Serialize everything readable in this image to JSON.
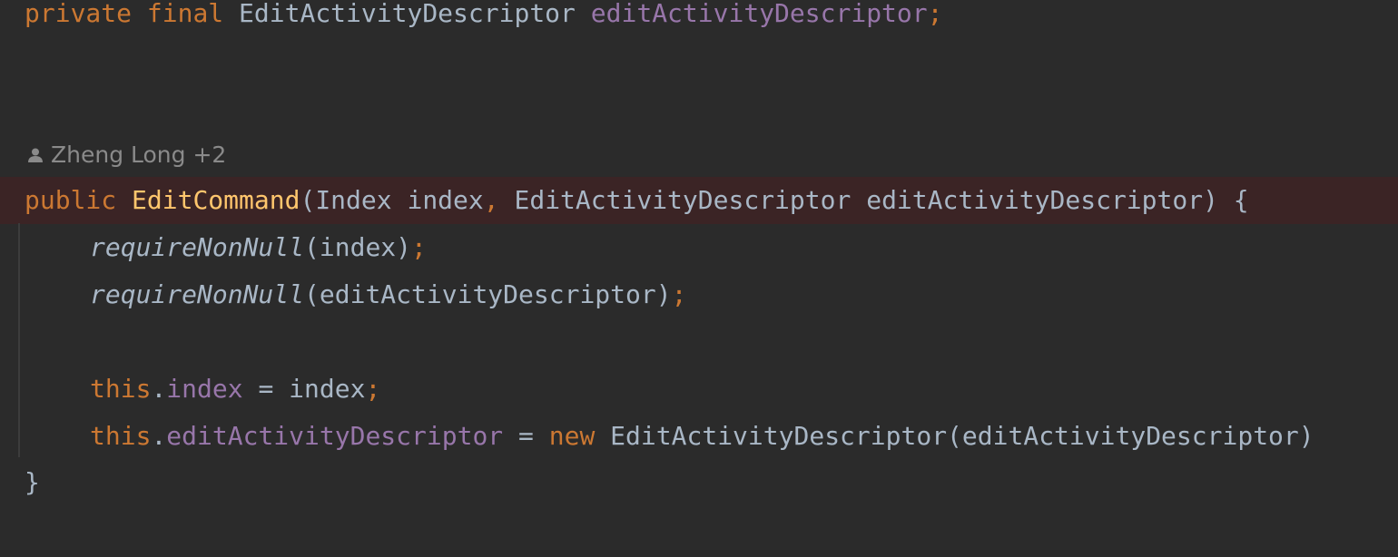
{
  "editor": {
    "field_declaration": {
      "modifier_private": "private",
      "modifier_final": "final",
      "type": "EditActivityDescriptor",
      "name": "editActivityDescriptor",
      "semicolon": ";"
    },
    "inlay_hint": {
      "author": "Zheng Long +2",
      "icon": "user-icon"
    },
    "constructor_signature": {
      "modifier": "public",
      "name": "EditCommand",
      "open_paren": "(",
      "param1_type": "Index",
      "param1_name": "index",
      "comma": ",",
      "param2_type": "EditActivityDescriptor",
      "param2_name": "editActivityDescriptor",
      "close_brace_open": ") {"
    },
    "require_line_1": {
      "method": "requireNonNull",
      "args": "(index)",
      "semicolon": ";"
    },
    "require_line_2": {
      "method": "requireNonNull",
      "args": "(editActivityDescriptor)",
      "semicolon": ";"
    },
    "assign_line_1": {
      "this_kw": "this",
      "dot": ".",
      "field": "index",
      "rest": " = index",
      "semicolon": ";"
    },
    "assign_line_2": {
      "this_kw": "this",
      "dot": ".",
      "field": "editActivityDescriptor",
      "equals": " = ",
      "new_kw": "new",
      "rest": " EditActivityDescriptor(editActivityDescriptor)"
    },
    "closing_brace": "}"
  },
  "colors": {
    "background": "#2b2b2b",
    "keyword": "#cc7832",
    "field": "#9876aa",
    "function_declaration": "#ffc66d",
    "default_text": "#a9b7c6",
    "highlight_line": "#3b2425",
    "inlay_hint": "#8a8a8a"
  }
}
